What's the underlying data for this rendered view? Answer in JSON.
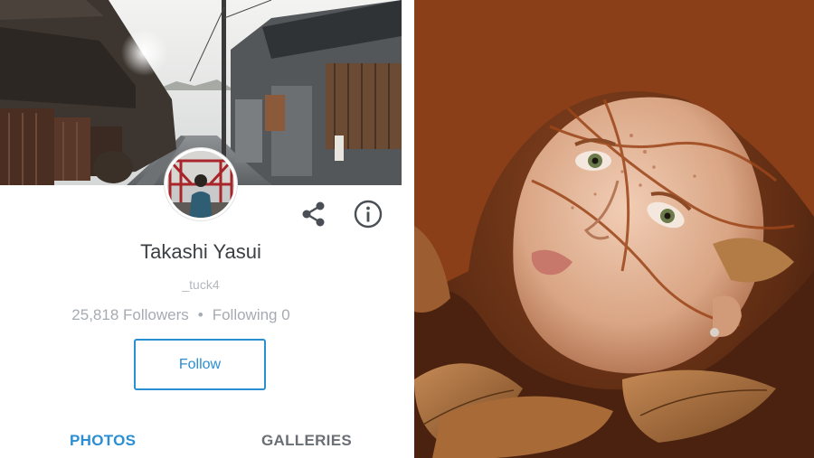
{
  "profile": {
    "name": "Takashi Yasui",
    "username": "_tuck4",
    "followers_text": "25,818 Followers",
    "separator": "•",
    "following_text": "Following 0",
    "follow_label": "Follow"
  },
  "tabs": {
    "photos_label": "PHOTOS",
    "galleries_label": "GALLERIES",
    "active": "PHOTOS"
  },
  "icons": {
    "share": "share-icon",
    "info": "info-icon"
  },
  "colors": {
    "accent": "#2a8ed3",
    "name_text": "#3a3f44",
    "muted_text": "#a6abb1",
    "inactive_tab": "#6a6f75"
  }
}
